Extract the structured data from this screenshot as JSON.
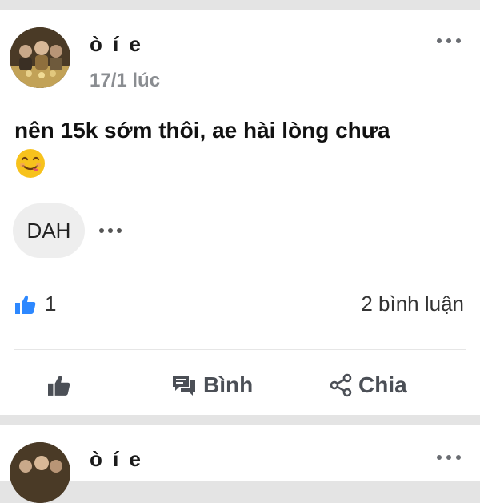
{
  "posts": [
    {
      "author": "ò í e",
      "timestamp": "17/1 lúc",
      "text": "nên 15k sớm thôi, ae hài lòng chưa",
      "emoji": "yum-face",
      "comment_preview": "DAH",
      "like_count": "1",
      "comment_count": "2 bình luận",
      "actions": {
        "like": "",
        "comment": "Bình",
        "share": "Chia"
      }
    },
    {
      "author": "ò í e"
    }
  ],
  "icons": {
    "more": "more-horizontal-icon",
    "like": "thumbs-up-icon",
    "comment": "comment-icon",
    "share": "share-icon"
  },
  "colors": {
    "like_blue": "#2d88ff",
    "action_gray": "#4b4f56",
    "emoji_yellow": "#f7c21c"
  }
}
